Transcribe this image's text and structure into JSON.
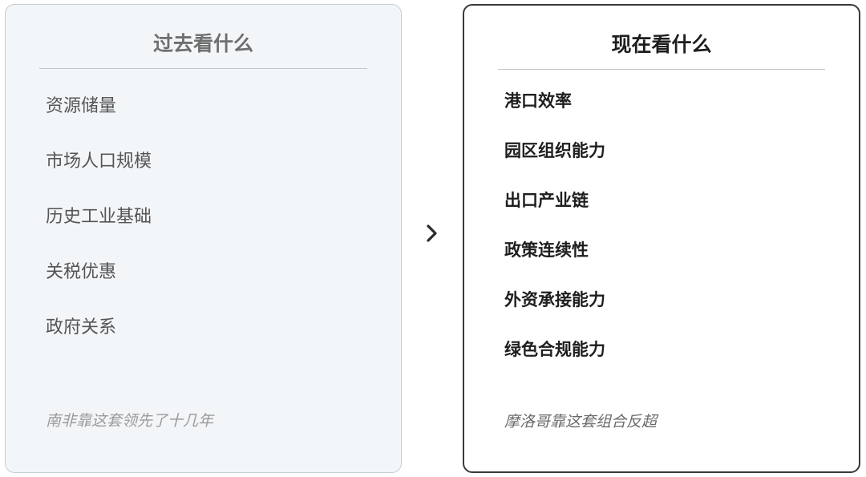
{
  "past": {
    "title": "过去看什么",
    "items": [
      "资源储量",
      "市场人口规模",
      "历史工业基础",
      "关税优惠",
      "政府关系"
    ],
    "footnote": "南非靠这套领先了十几年"
  },
  "now": {
    "title": "现在看什么",
    "items": [
      "港口效率",
      "园区组织能力",
      "出口产业链",
      "政策连续性",
      "外资承接能力",
      "绿色合规能力"
    ],
    "footnote": "摩洛哥靠这套组合反超"
  },
  "arrow_icon": "chevron-right-icon",
  "colors": {
    "past_panel_bg": "#f3f6f9",
    "now_panel_border": "#3a3a3a",
    "past_text": "#555555",
    "now_text": "#1e1e1e"
  }
}
